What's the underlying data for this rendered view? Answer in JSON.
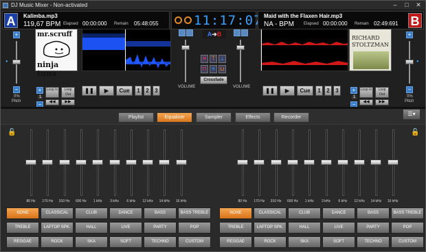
{
  "window": {
    "title": "DJ Music Mixer - Non-activated",
    "minimize": "–",
    "maximize": "□",
    "close": "✕"
  },
  "deckA": {
    "badge": "A",
    "title": "Kalimba.mp3",
    "bpm": "119,67 BPM",
    "elapsed_label": "Elapsed",
    "elapsed": "00:00:000",
    "remain_label": "Remain",
    "remain": "05:48:055",
    "cover_line1": "mr.scruff",
    "cover_line2": "ninja tuna",
    "pitch_pct": "0%",
    "pitch_label": "Pitch",
    "cue": "Cue",
    "h1": "1",
    "h2": "2",
    "h3": "3",
    "loop_in": "Loop In",
    "loop_out": "Loop Out",
    "loop_count": "1",
    "wave_color": "#1e56ff"
  },
  "deckB": {
    "badge": "B",
    "title": "Maid with the Flaxen Hair.mp3",
    "bpm": "NA - BPM",
    "elapsed_label": "Elapsed",
    "elapsed": "00:00:000",
    "remain_label": "Remain",
    "remain": "02:49:691",
    "cover_line1": "RICHARD",
    "cover_line2": "STOLTZMAN",
    "pitch_pct": "0%",
    "pitch_label": "Pitch",
    "cue": "Cue",
    "h1": "1",
    "h2": "2",
    "h3": "3",
    "loop_in": "Loop In",
    "loop_out": "Loop Out",
    "loop_count": "1",
    "wave_color": "#d01818"
  },
  "mixer": {
    "clock": "11:17:07",
    "volume_label": "VOLUME",
    "crossfade": "Crossfade",
    "ab": "A",
    "ba": "B"
  },
  "tabs": [
    "Playlist",
    "Equalizer",
    "Sampler",
    "Effects",
    "Recorder"
  ],
  "active_tab": "Equalizer",
  "eq_bands": [
    "80 Hz",
    "170 Hz",
    "310 Hz",
    "600 Hz",
    "1 kHz",
    "3 kHz",
    "6 kHz",
    "12 kHz",
    "14 kHz",
    "16 kHz"
  ],
  "presets": [
    "NONE",
    "CLASSICAL",
    "CLUB",
    "DANCE",
    "BASS",
    "BASS TREBLE",
    "TREBLE",
    "LAPTOP SPK.",
    "HALL",
    "LIVE",
    "PARTY",
    "POP",
    "REGGAE",
    "ROCK",
    "SKA",
    "SOFT",
    "TECHNO",
    "CUSTOM"
  ],
  "active_preset": "NONE",
  "colors": {
    "accent": "#f0902e",
    "deckA": "#1a3fa6",
    "deckB": "#c21919",
    "clock": "#3aa0ff"
  }
}
